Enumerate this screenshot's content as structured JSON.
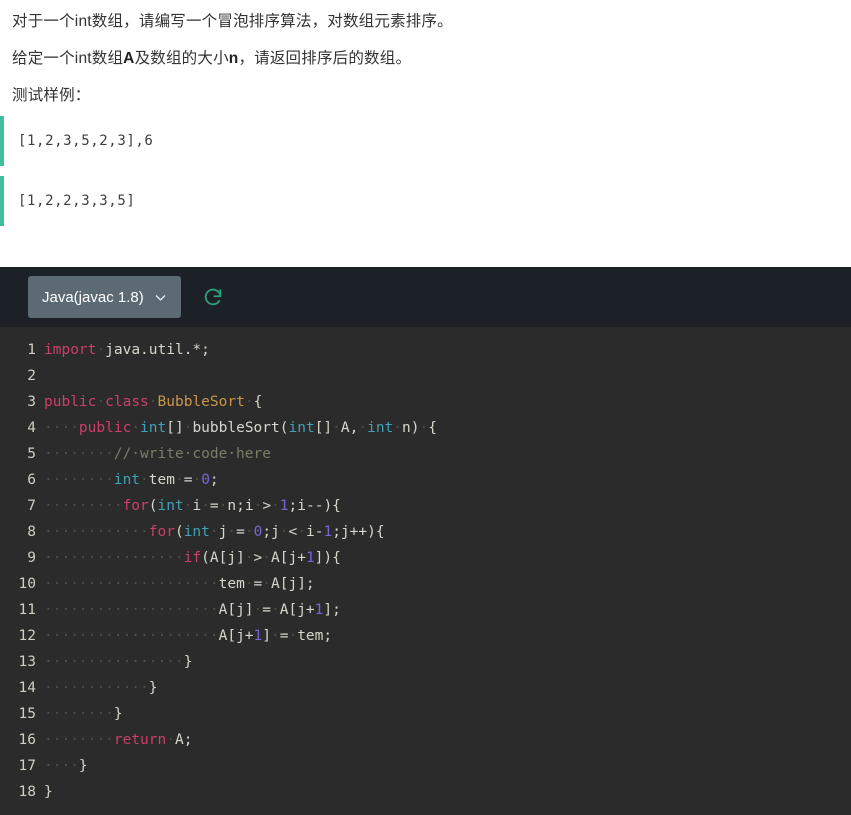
{
  "problem": {
    "line1_before": "对于一个int数组，请编写一个冒泡排序算法，对数组元素排序。",
    "line2_a": "给定一个int数组",
    "line2_bold1": "A",
    "line2_b": "及数组的大小",
    "line2_bold2": "n",
    "line2_c": "，请返回排序后的数组。",
    "sample_label": "测试样例："
  },
  "samples": [
    {
      "text": "[1,2,3,5,2,3],6"
    },
    {
      "text": "[1,2,2,3,3,5]"
    }
  ],
  "editor": {
    "language_label": "Java(javac 1.8)",
    "chevron_icon": "chevron-down-icon",
    "refresh_icon": "refresh-icon",
    "accent_color": "#3fbf9e",
    "toolbar_bg": "#1b2127",
    "code_bg": "#2b2b2b",
    "select_bg": "#5c6b73"
  },
  "code": {
    "language": "java",
    "lines": [
      {
        "n": "1",
        "tokens": [
          {
            "t": "import",
            "c": "kw"
          },
          {
            "t": "·",
            "c": "ws"
          },
          {
            "t": "java.util.*;",
            "c": "pln"
          }
        ]
      },
      {
        "n": "2",
        "tokens": []
      },
      {
        "n": "3",
        "tokens": [
          {
            "t": "public",
            "c": "kw"
          },
          {
            "t": "·",
            "c": "ws"
          },
          {
            "t": "class",
            "c": "kw"
          },
          {
            "t": "·",
            "c": "ws"
          },
          {
            "t": "BubbleSort",
            "c": "cls"
          },
          {
            "t": "·",
            "c": "ws"
          },
          {
            "t": "{",
            "c": "pln"
          }
        ]
      },
      {
        "n": "4",
        "tokens": [
          {
            "t": "····",
            "c": "ws"
          },
          {
            "t": "public",
            "c": "kw"
          },
          {
            "t": "·",
            "c": "ws"
          },
          {
            "t": "int",
            "c": "type"
          },
          {
            "t": "[]",
            "c": "pln"
          },
          {
            "t": "·",
            "c": "ws"
          },
          {
            "t": "bubbleSort(",
            "c": "pln"
          },
          {
            "t": "int",
            "c": "type"
          },
          {
            "t": "[]",
            "c": "pln"
          },
          {
            "t": "·",
            "c": "ws"
          },
          {
            "t": "A,",
            "c": "pln"
          },
          {
            "t": "·",
            "c": "ws"
          },
          {
            "t": "int",
            "c": "type"
          },
          {
            "t": "·",
            "c": "ws"
          },
          {
            "t": "n)",
            "c": "pln"
          },
          {
            "t": "·",
            "c": "ws"
          },
          {
            "t": "{",
            "c": "pln"
          }
        ]
      },
      {
        "n": "5",
        "tokens": [
          {
            "t": "········",
            "c": "ws"
          },
          {
            "t": "//·write·code·here",
            "c": "com"
          }
        ]
      },
      {
        "n": "6",
        "tokens": [
          {
            "t": "········",
            "c": "ws"
          },
          {
            "t": "int",
            "c": "type"
          },
          {
            "t": "·",
            "c": "ws"
          },
          {
            "t": "tem",
            "c": "pln"
          },
          {
            "t": "·",
            "c": "ws"
          },
          {
            "t": "=",
            "c": "pln"
          },
          {
            "t": "·",
            "c": "ws"
          },
          {
            "t": "0",
            "c": "num"
          },
          {
            "t": ";",
            "c": "pln"
          }
        ]
      },
      {
        "n": "7",
        "tokens": [
          {
            "t": "········",
            "c": "ws"
          },
          {
            "t": "·",
            "c": "ws"
          },
          {
            "t": "for",
            "c": "kw"
          },
          {
            "t": "(",
            "c": "pln"
          },
          {
            "t": "int",
            "c": "type"
          },
          {
            "t": "·",
            "c": "ws"
          },
          {
            "t": "i",
            "c": "pln"
          },
          {
            "t": "·",
            "c": "ws"
          },
          {
            "t": "=",
            "c": "pln"
          },
          {
            "t": "·",
            "c": "ws"
          },
          {
            "t": "n;i",
            "c": "pln"
          },
          {
            "t": "·",
            "c": "ws"
          },
          {
            "t": ">",
            "c": "pln"
          },
          {
            "t": "·",
            "c": "ws"
          },
          {
            "t": "1",
            "c": "num"
          },
          {
            "t": ";i--){",
            "c": "pln"
          }
        ]
      },
      {
        "n": "8",
        "tokens": [
          {
            "t": "············",
            "c": "ws"
          },
          {
            "t": "for",
            "c": "kw"
          },
          {
            "t": "(",
            "c": "pln"
          },
          {
            "t": "int",
            "c": "type"
          },
          {
            "t": "·",
            "c": "ws"
          },
          {
            "t": "j",
            "c": "pln"
          },
          {
            "t": "·",
            "c": "ws"
          },
          {
            "t": "=",
            "c": "pln"
          },
          {
            "t": "·",
            "c": "ws"
          },
          {
            "t": "0",
            "c": "num"
          },
          {
            "t": ";j",
            "c": "pln"
          },
          {
            "t": "·",
            "c": "ws"
          },
          {
            "t": "<",
            "c": "pln"
          },
          {
            "t": "·",
            "c": "ws"
          },
          {
            "t": "i-",
            "c": "pln"
          },
          {
            "t": "1",
            "c": "num"
          },
          {
            "t": ";j++){",
            "c": "pln"
          }
        ]
      },
      {
        "n": "9",
        "tokens": [
          {
            "t": "················",
            "c": "ws"
          },
          {
            "t": "if",
            "c": "kw"
          },
          {
            "t": "(A[j]",
            "c": "pln"
          },
          {
            "t": "·",
            "c": "ws"
          },
          {
            "t": ">",
            "c": "pln"
          },
          {
            "t": "·",
            "c": "ws"
          },
          {
            "t": "A[j+",
            "c": "pln"
          },
          {
            "t": "1",
            "c": "num"
          },
          {
            "t": "]){",
            "c": "pln"
          }
        ]
      },
      {
        "n": "10",
        "tokens": [
          {
            "t": "····················",
            "c": "ws"
          },
          {
            "t": "tem",
            "c": "pln"
          },
          {
            "t": "·",
            "c": "ws"
          },
          {
            "t": "=",
            "c": "pln"
          },
          {
            "t": "·",
            "c": "ws"
          },
          {
            "t": "A[j];",
            "c": "pln"
          }
        ]
      },
      {
        "n": "11",
        "tokens": [
          {
            "t": "····················",
            "c": "ws"
          },
          {
            "t": "A[j]",
            "c": "pln"
          },
          {
            "t": "·",
            "c": "ws"
          },
          {
            "t": "=",
            "c": "pln"
          },
          {
            "t": "·",
            "c": "ws"
          },
          {
            "t": "A[j+",
            "c": "pln"
          },
          {
            "t": "1",
            "c": "num"
          },
          {
            "t": "];",
            "c": "pln"
          }
        ]
      },
      {
        "n": "12",
        "tokens": [
          {
            "t": "····················",
            "c": "ws"
          },
          {
            "t": "A[j+",
            "c": "pln"
          },
          {
            "t": "1",
            "c": "num"
          },
          {
            "t": "]",
            "c": "pln"
          },
          {
            "t": "·",
            "c": "ws"
          },
          {
            "t": "=",
            "c": "pln"
          },
          {
            "t": "·",
            "c": "ws"
          },
          {
            "t": "tem;",
            "c": "pln"
          }
        ]
      },
      {
        "n": "13",
        "tokens": [
          {
            "t": "················",
            "c": "ws"
          },
          {
            "t": "}",
            "c": "pln"
          }
        ]
      },
      {
        "n": "14",
        "tokens": [
          {
            "t": "············",
            "c": "ws"
          },
          {
            "t": "}",
            "c": "pln"
          }
        ]
      },
      {
        "n": "15",
        "tokens": [
          {
            "t": "········",
            "c": "ws"
          },
          {
            "t": "}",
            "c": "pln"
          }
        ]
      },
      {
        "n": "16",
        "tokens": [
          {
            "t": "········",
            "c": "ws"
          },
          {
            "t": "return",
            "c": "kw"
          },
          {
            "t": "·",
            "c": "ws"
          },
          {
            "t": "A;",
            "c": "pln"
          }
        ]
      },
      {
        "n": "17",
        "tokens": [
          {
            "t": "····",
            "c": "ws"
          },
          {
            "t": "}",
            "c": "pln"
          }
        ]
      },
      {
        "n": "18",
        "tokens": [
          {
            "t": "}",
            "c": "pln"
          }
        ]
      }
    ]
  }
}
